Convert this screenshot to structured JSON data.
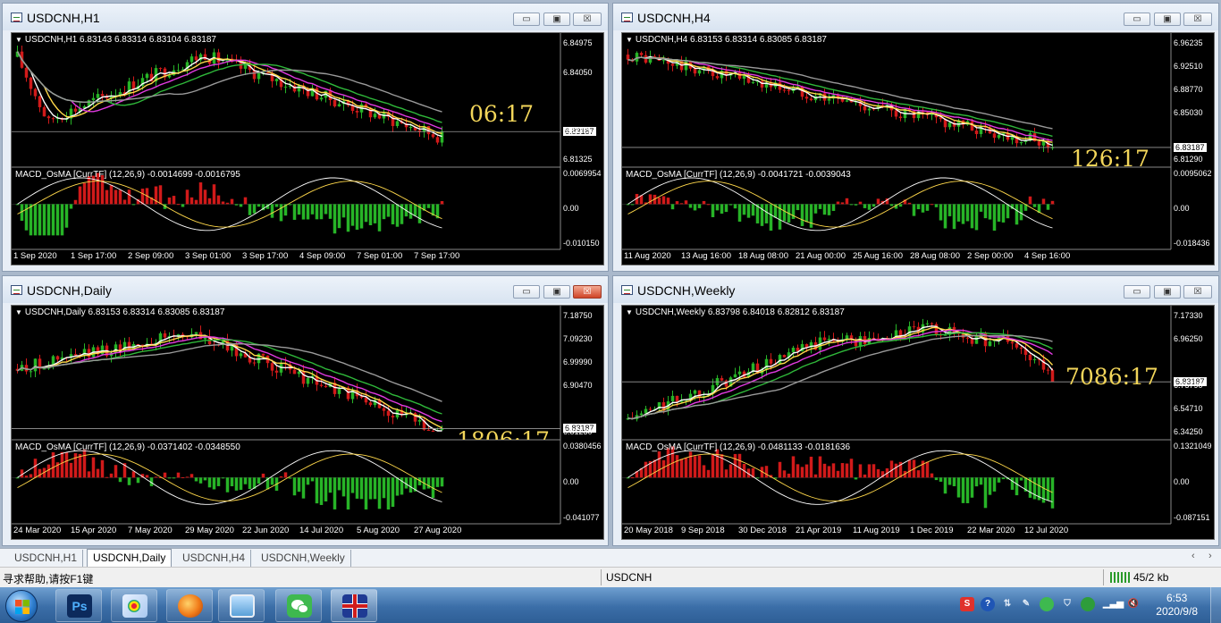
{
  "windows": [
    {
      "title": "USDCNH,H1",
      "header": "USDCNH,H1  6.83143 6.83314 6.83104 6.83187",
      "price_labels": [
        "6.84975",
        "6.84050",
        "6.83187",
        "6.82225",
        "6.81325"
      ],
      "current_price": "6.83187",
      "macd_header": "MACD_OsMA [CurrTF] (12,26,9) -0.0014699 -0.0016795",
      "macd_labels": [
        "0.0069954",
        "0.00",
        "-0.010150"
      ],
      "time_labels": [
        "1 Sep 2020",
        "1 Sep 17:00",
        "2 Sep 09:00",
        "3 Sep 01:00",
        "3 Sep 17:00",
        "4 Sep 09:00",
        "7 Sep 01:00",
        "7 Sep 17:00"
      ],
      "timer": "06:17",
      "trend": "down-then-flat",
      "close_active": false
    },
    {
      "title": "USDCNH,H4",
      "header": "USDCNH,H4  6.83153 6.83314 6.83085 6.83187",
      "price_labels": [
        "6.96235",
        "6.92510",
        "6.88770",
        "6.85030",
        "6.83187",
        "6.81290"
      ],
      "current_price": "6.83187",
      "macd_header": "MACD_OsMA [CurrTF] (12,26,9) -0.0041721 -0.0039043",
      "macd_labels": [
        "0.0095062",
        "0.00",
        "-0.018436"
      ],
      "time_labels": [
        "11 Aug 2020",
        "13 Aug 16:00",
        "18 Aug 08:00",
        "21 Aug 00:00",
        "25 Aug 16:00",
        "28 Aug 08:00",
        "2 Sep 00:00",
        "4 Sep 16:00"
      ],
      "timer": "126:17",
      "trend": "down",
      "close_active": false
    },
    {
      "title": "USDCNH,Daily",
      "header": "USDCNH,Daily  6.83153 6.83314 6.83085 6.83187",
      "price_labels": [
        "7.18750",
        "7.09230",
        "6.99990",
        "6.90470",
        "6.83187",
        "6.81230"
      ],
      "current_price": "6.83187",
      "macd_header": "MACD_OsMA [CurrTF] (12,26,9) -0.0371402 -0.0348550",
      "macd_labels": [
        "0.0380456",
        "0.00",
        "-0.041077"
      ],
      "time_labels": [
        "24 Mar 2020",
        "15 Apr 2020",
        "7 May 2020",
        "29 May 2020",
        "22 Jun 2020",
        "14 Jul 2020",
        "5 Aug 2020",
        "27 Aug 2020"
      ],
      "timer": "1806:17",
      "trend": "up-then-down",
      "close_active": true
    },
    {
      "title": "USDCNH,Weekly",
      "header": "USDCNH,Weekly  6.83798 6.84018 6.82812 6.83187",
      "price_labels": [
        "7.17330",
        "6.96250",
        "6.83187",
        "6.75790",
        "6.54710",
        "6.34250"
      ],
      "current_price": "6.83187",
      "macd_header": "MACD_OsMA [CurrTF] (12,26,9) -0.0481133 -0.0181636",
      "macd_labels": [
        "0.1321049",
        "0.00",
        "-0.087151"
      ],
      "time_labels": [
        "20 May 2018",
        "9 Sep 2018",
        "30 Dec 2018",
        "21 Apr 2019",
        "11 Aug 2019",
        "1 Dec 2019",
        "22 Mar 2020",
        "12 Jul 2020"
      ],
      "timer": "7086:17",
      "trend": "rise-plateau-drop",
      "close_active": false
    }
  ],
  "window_buttons": {
    "minimize": "▭",
    "maximize": "▣",
    "close": "☒"
  },
  "tabs": [
    "USDCNH,H1",
    "USDCNH,Daily",
    "USDCNH,H4",
    "USDCNH,Weekly"
  ],
  "active_tab": "USDCNH,Daily",
  "tab_nav": {
    "left": "‹",
    "right": "›"
  },
  "status": {
    "help": "寻求帮助,请按F1键",
    "symbol": "USDCNH",
    "traffic": "45/2 kb"
  },
  "taskbar": {
    "apps": [
      "start-orb",
      "photoshop",
      "paint",
      "firefox-like",
      "photo-viewer",
      "wechat",
      "uk-flag-app"
    ],
    "photoshop_label": "Ps",
    "time": "6:53",
    "date": "2020/9/8"
  },
  "colors": {
    "bull": "#27b427",
    "bear": "#d11a1a",
    "ma_white": "#ffffff",
    "ma_yellow": "#ffd84a",
    "ma_magenta": "#e13ae1",
    "ma_green": "#2fb83a",
    "ma_gray": "#9a9a9a",
    "timer": "#f3d65a"
  }
}
